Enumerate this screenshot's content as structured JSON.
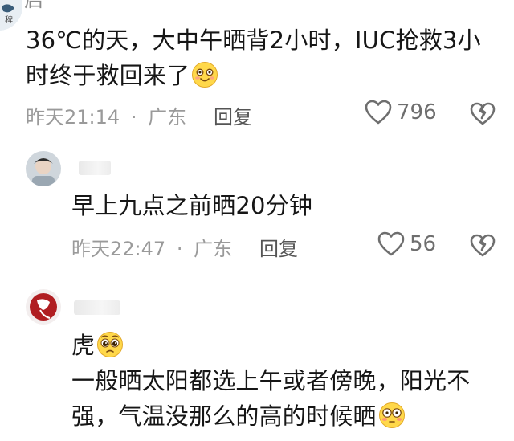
{
  "comments": [
    {
      "name_partial": "启",
      "lines": [
        "36℃的天，大中午晒背2小时，IUC抢救3小",
        "时终于救回来了"
      ],
      "emoji": "smiling-face-emoji",
      "time": "昨天21:14",
      "dot": "·",
      "location": "广东",
      "reply_label": "回复",
      "likes": "796"
    },
    {
      "lines": [
        "早上九点之前晒20分钟"
      ],
      "time": "昨天22:47",
      "dot": "·",
      "location": "广东",
      "reply_label": "回复",
      "likes": "56"
    },
    {
      "lines": [
        "虎",
        "一般晒太阳都选上午或者傍晚，阳光不",
        "强，气温没那么的高的时候晒"
      ],
      "emoji_line1": "pleading-face-emoji",
      "emoji_line3": "flushed-face-emoji"
    }
  ],
  "colors": {
    "meta": "#9a9a9a",
    "text": "#161616",
    "icon": "#6e6e6e"
  }
}
